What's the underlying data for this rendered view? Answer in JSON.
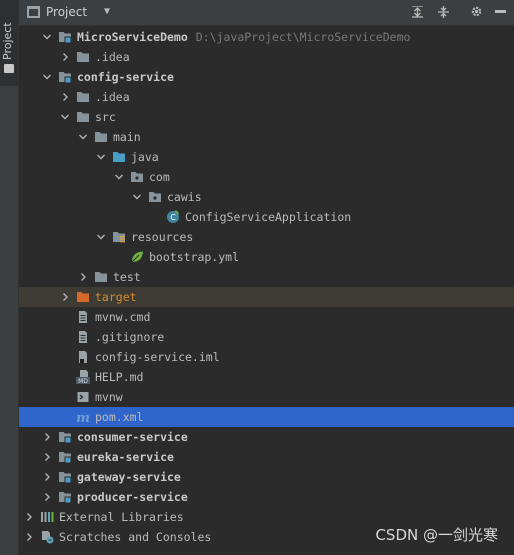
{
  "side_strip": {
    "tab_label": "Project"
  },
  "header": {
    "title": "Project",
    "icons": [
      "collapse-all-icon",
      "expand-all-icon",
      "gear-icon",
      "minimize-icon"
    ]
  },
  "tree": [
    {
      "label": "MicroServiceDemo",
      "path": "D:\\javaProject\\MicroServiceDemo",
      "bold": true,
      "icon": "module-folder",
      "arrow": "down"
    },
    {
      "label": ".idea",
      "icon": "folder",
      "arrow": "right"
    },
    {
      "label": "config-service",
      "bold": true,
      "icon": "module-folder",
      "arrow": "down"
    },
    {
      "label": ".idea",
      "icon": "folder",
      "arrow": "right"
    },
    {
      "label": "src",
      "icon": "folder",
      "arrow": "down"
    },
    {
      "label": "main",
      "icon": "folder",
      "arrow": "down"
    },
    {
      "label": "java",
      "icon": "source-folder",
      "arrow": "down"
    },
    {
      "label": "com",
      "icon": "package",
      "arrow": "down"
    },
    {
      "label": "cawis",
      "icon": "package",
      "arrow": "down"
    },
    {
      "label": "ConfigServiceApplication",
      "icon": "spring-class"
    },
    {
      "label": "resources",
      "icon": "resources-folder",
      "arrow": "down"
    },
    {
      "label": "bootstrap.yml",
      "icon": "spring-leaf"
    },
    {
      "label": "test",
      "icon": "folder",
      "arrow": "right"
    },
    {
      "label": "target",
      "icon": "excluded-folder",
      "arrow": "right",
      "excluded": true
    },
    {
      "label": "mvnw.cmd",
      "icon": "text-file"
    },
    {
      "label": ".gitignore",
      "icon": "text-file"
    },
    {
      "label": "config-service.iml",
      "icon": "iml-file"
    },
    {
      "label": "HELP.md",
      "icon": "md-file"
    },
    {
      "label": "mvnw",
      "icon": "shell-file"
    },
    {
      "label": "pom.xml",
      "icon": "maven-file",
      "selected": true
    },
    {
      "label": "consumer-service",
      "bold": true,
      "icon": "module-folder",
      "arrow": "right"
    },
    {
      "label": "eureka-service",
      "bold": true,
      "icon": "module-folder",
      "arrow": "right"
    },
    {
      "label": "gateway-service",
      "bold": true,
      "icon": "module-folder",
      "arrow": "right"
    },
    {
      "label": "producer-service",
      "bold": true,
      "icon": "module-folder",
      "arrow": "right"
    },
    {
      "label": "External Libraries",
      "icon": "libraries",
      "arrow": "right"
    },
    {
      "label": "Scratches and Consoles",
      "icon": "scratches",
      "arrow": "right"
    }
  ],
  "watermark": "CSDN @一剑光寒",
  "colors": {
    "selection": "#2f65ca",
    "excluded_row": "#3d3b33",
    "excluded_label": "#d58c2f",
    "folder": "#87939a",
    "source_folder": "#4a9ec5",
    "module_badge": "#4a9ec5"
  }
}
